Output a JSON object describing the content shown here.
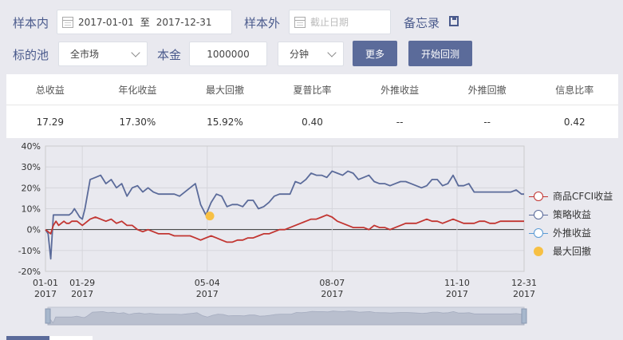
{
  "filters": {
    "in_sample_label": "样本内",
    "start_date": "2017-01-01",
    "to_label": "至",
    "end_date": "2017-12-31",
    "out_sample_label": "样本外",
    "out_placeholder": "截止日期",
    "memo_label": "备忘录",
    "pool_label": "标的池",
    "pool_value": "全市场",
    "capital_label": "本金",
    "capital_value": "1000000",
    "freq_value": "分钟",
    "more_button": "更多",
    "start_button": "开始回测"
  },
  "stats": {
    "headers": [
      "总收益",
      "年化收益",
      "最大回撤",
      "夏普比率",
      "外推收益",
      "外推回撤",
      "信息比率"
    ],
    "values": [
      "17.29",
      "17.30%",
      "15.92%",
      "0.40",
      "--",
      "--",
      "0.42"
    ]
  },
  "legend": [
    "商品CFCI收益",
    "策略收益",
    "外推收益",
    "最大回撤"
  ],
  "colors": {
    "benchmark": "#c23531",
    "strategy": "#5b6b9a",
    "extrap": "#5b9bd5",
    "drawdown": "#f7c044"
  },
  "chart_data": {
    "type": "line",
    "y_ticks": [
      "40%",
      "30%",
      "20%",
      "10%",
      "0%",
      "-10%",
      "-20%"
    ],
    "ylim": [
      -20,
      40
    ],
    "x_ticks": [
      {
        "md": "01-01",
        "y": "2017"
      },
      {
        "md": "01-29",
        "y": "2017"
      },
      {
        "md": "05-04",
        "y": "2017"
      },
      {
        "md": "08-07",
        "y": "2017"
      },
      {
        "md": "11-10",
        "y": "2017"
      },
      {
        "md": "12-31",
        "y": "2017"
      }
    ],
    "series": [
      {
        "name": "策略收益",
        "x": [
          0,
          2,
          4,
          6,
          8,
          10,
          12,
          14,
          16,
          18,
          20,
          22,
          24,
          26,
          28,
          30,
          34,
          38,
          42,
          46,
          50,
          54,
          58,
          62,
          66,
          70,
          74,
          78,
          82,
          86,
          90,
          94,
          98,
          102,
          106,
          110,
          114,
          118,
          122,
          126,
          130,
          134,
          138,
          142,
          146,
          150,
          154,
          158,
          162,
          166,
          170,
          174,
          178,
          182,
          186,
          190,
          194,
          198,
          202,
          206,
          210,
          214,
          218,
          222,
          226,
          230,
          234,
          238,
          242,
          246,
          250,
          254,
          258,
          262,
          266,
          270,
          274,
          278,
          282,
          286,
          290,
          294,
          298,
          302,
          306,
          310,
          314,
          318,
          322,
          326,
          330,
          334,
          338,
          342,
          346,
          350,
          354,
          358,
          362,
          364
        ],
        "y": [
          0,
          -2,
          -14,
          7,
          7,
          7,
          7,
          7,
          7,
          7,
          8,
          10,
          8,
          6,
          5,
          10,
          24,
          25,
          26,
          22,
          24,
          20,
          22,
          16,
          20,
          21,
          18,
          20,
          18,
          17,
          17,
          17,
          17,
          16,
          18,
          20,
          22,
          12,
          7,
          13,
          17,
          16,
          11,
          12,
          12,
          11,
          14,
          14,
          10,
          11,
          13,
          16,
          17,
          17,
          17,
          23,
          22,
          24,
          27,
          26,
          26,
          25,
          28,
          27,
          26,
          28,
          27,
          24,
          25,
          26,
          23,
          22,
          22,
          21,
          22,
          23,
          23,
          22,
          21,
          20,
          21,
          24,
          24,
          21,
          22,
          26,
          21,
          21,
          22,
          18,
          18,
          18,
          18,
          18,
          18,
          18,
          18,
          19,
          17,
          17
        ]
      },
      {
        "name": "商品CFCI收益",
        "x": [
          0,
          2,
          4,
          6,
          8,
          10,
          12,
          14,
          16,
          18,
          20,
          22,
          24,
          26,
          28,
          30,
          34,
          38,
          42,
          46,
          50,
          54,
          58,
          62,
          66,
          70,
          74,
          78,
          82,
          86,
          90,
          94,
          98,
          102,
          106,
          110,
          114,
          118,
          122,
          126,
          130,
          134,
          138,
          142,
          146,
          150,
          154,
          158,
          162,
          166,
          170,
          174,
          178,
          182,
          186,
          190,
          194,
          198,
          202,
          206,
          210,
          214,
          218,
          222,
          226,
          230,
          234,
          238,
          242,
          246,
          250,
          254,
          258,
          262,
          266,
          270,
          274,
          278,
          282,
          286,
          290,
          294,
          298,
          302,
          306,
          310,
          314,
          318,
          322,
          326,
          330,
          334,
          338,
          342,
          346,
          350,
          354,
          358,
          362,
          364
        ],
        "y": [
          0,
          -1,
          -2,
          2,
          4,
          2,
          3,
          4,
          3,
          3,
          4,
          4,
          4,
          3,
          2,
          3,
          5,
          6,
          5,
          4,
          5,
          3,
          4,
          2,
          2,
          0,
          -1,
          0,
          -1,
          -2,
          -2,
          -2,
          -3,
          -3,
          -3,
          -3,
          -4,
          -5,
          -4,
          -3,
          -4,
          -5,
          -6,
          -6,
          -5,
          -5,
          -4,
          -4,
          -3,
          -2,
          -2,
          -1,
          0,
          0,
          1,
          2,
          3,
          4,
          5,
          5,
          6,
          7,
          6,
          4,
          3,
          2,
          1,
          1,
          1,
          0,
          2,
          1,
          1,
          0,
          1,
          2,
          3,
          3,
          3,
          4,
          5,
          4,
          4,
          3,
          4,
          5,
          4,
          3,
          3,
          3,
          4,
          4,
          3,
          3,
          4,
          4,
          4,
          4,
          4,
          4
        ]
      }
    ],
    "drawdown_point": {
      "x": 125,
      "y": 6.5
    }
  }
}
